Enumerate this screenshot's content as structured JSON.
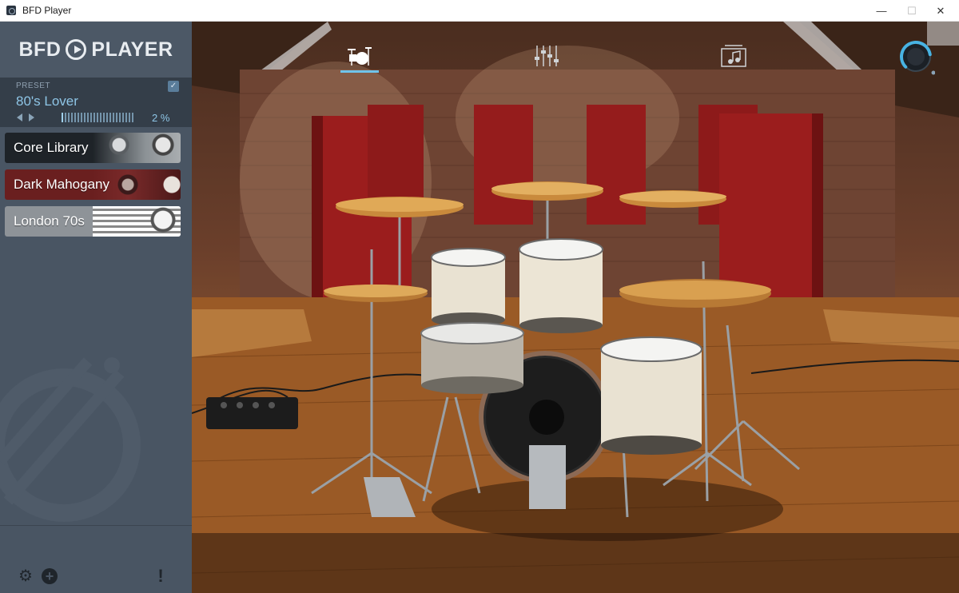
{
  "window": {
    "title": "BFD Player",
    "minimize_glyph": "—",
    "maximize_glyph": "☐",
    "close_glyph": "✕"
  },
  "sidebar": {
    "logo_left": "BFD",
    "logo_right": "PLAYER",
    "preset": {
      "caption": "PRESET",
      "name": "80's Lover",
      "progress_value": 0.02,
      "progress_label": "2 %"
    },
    "kits": [
      {
        "label": "Core Library"
      },
      {
        "label": "Dark Mahogany"
      },
      {
        "label": "London 70s"
      }
    ],
    "footer": {
      "settings_icon": "gear-icon",
      "add_icon": "plus-icon",
      "alert_icon": "exclamation-icon"
    }
  },
  "stage": {
    "tabs": [
      {
        "name": "kit",
        "icon": "drum-kit-icon",
        "active": true
      },
      {
        "name": "mixer",
        "icon": "mixer-sliders-icon",
        "active": false
      },
      {
        "name": "grooves",
        "icon": "music-note-icon",
        "active": false
      }
    ],
    "master_volume": 0.8
  },
  "colors": {
    "sidebar": "#495563",
    "preset_panel": "#343e49",
    "accent": "#6fc3ea",
    "preset_text": "#8ec5e6"
  }
}
